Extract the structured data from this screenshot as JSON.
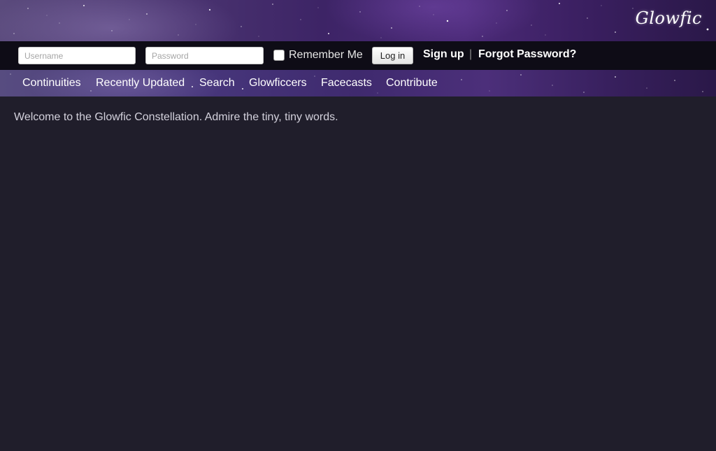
{
  "header": {
    "logo_text": "Glowfic"
  },
  "login": {
    "username_placeholder": "Username",
    "password_placeholder": "Password",
    "remember_label": "Remember Me",
    "login_button": "Log in",
    "signup_link": "Sign up",
    "separator": "|",
    "forgot_link": "Forgot Password?"
  },
  "nav": {
    "items": [
      {
        "label": "Continuities"
      },
      {
        "label": "Recently Updated"
      },
      {
        "label": "Search"
      },
      {
        "label": "Glowficcers"
      },
      {
        "label": "Facecasts"
      },
      {
        "label": "Contribute"
      }
    ]
  },
  "main": {
    "welcome_text": "Welcome to the Glowfic Constellation. Admire the tiny, tiny words."
  },
  "colors": {
    "background": "#201e2b",
    "login_bar": "#0e0c16",
    "banner_purple": "#3d2466"
  }
}
